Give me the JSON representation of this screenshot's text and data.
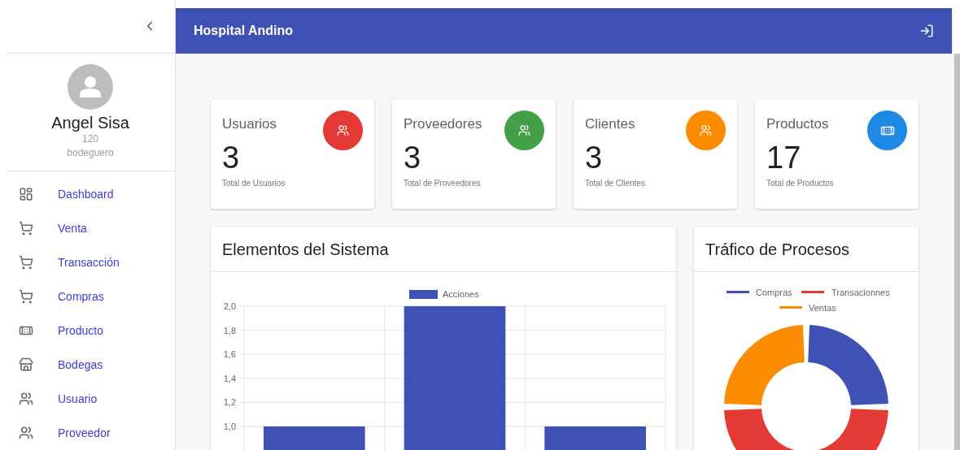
{
  "header": {
    "title": "Hospital Andino"
  },
  "user": {
    "name": "Angel Sisa",
    "code": "120",
    "role": "bodeguero"
  },
  "nav": [
    {
      "label": "Dashboard"
    },
    {
      "label": "Venta"
    },
    {
      "label": "Transacción"
    },
    {
      "label": "Compras"
    },
    {
      "label": "Producto"
    },
    {
      "label": "Bodegas"
    },
    {
      "label": "Usuario"
    },
    {
      "label": "Proveedor"
    }
  ],
  "stats": [
    {
      "title": "Usuarios",
      "value": "3",
      "caption": "Total de Usuarios",
      "color": "#e53935"
    },
    {
      "title": "Proveedores",
      "value": "3",
      "caption": "Total de Proveedores",
      "color": "#43a047"
    },
    {
      "title": "Clientes",
      "value": "3",
      "caption": "Total de Clientes",
      "color": "#fb8c00"
    },
    {
      "title": "Productos",
      "value": "17",
      "caption": "Total de Productos",
      "color": "#1e88e5"
    }
  ],
  "bar_panel": {
    "title": "Elementos del Sistema",
    "chart_data": {
      "type": "bar",
      "grid": true,
      "ylim": [
        0,
        2
      ],
      "yticks": [
        {
          "value": 1.0,
          "label": "1,0"
        },
        {
          "value": 1.2,
          "label": "1,2"
        },
        {
          "value": 1.4,
          "label": "1,4"
        },
        {
          "value": 1.6,
          "label": "1,6"
        },
        {
          "value": 1.8,
          "label": "1,8"
        },
        {
          "value": 2.0,
          "label": "2,0"
        }
      ],
      "series": [
        {
          "name": "Acciones",
          "color": "#3f51b5",
          "values": [
            1,
            2,
            1
          ]
        }
      ]
    }
  },
  "donut_panel": {
    "title": "Tráfico de Procesos",
    "legend": [
      {
        "label": "Compras",
        "color": "#3f51b5"
      },
      {
        "label": "Transacionnes",
        "color": "#e53935"
      },
      {
        "label": "Ventas",
        "color": "#fb8c00"
      }
    ]
  }
}
